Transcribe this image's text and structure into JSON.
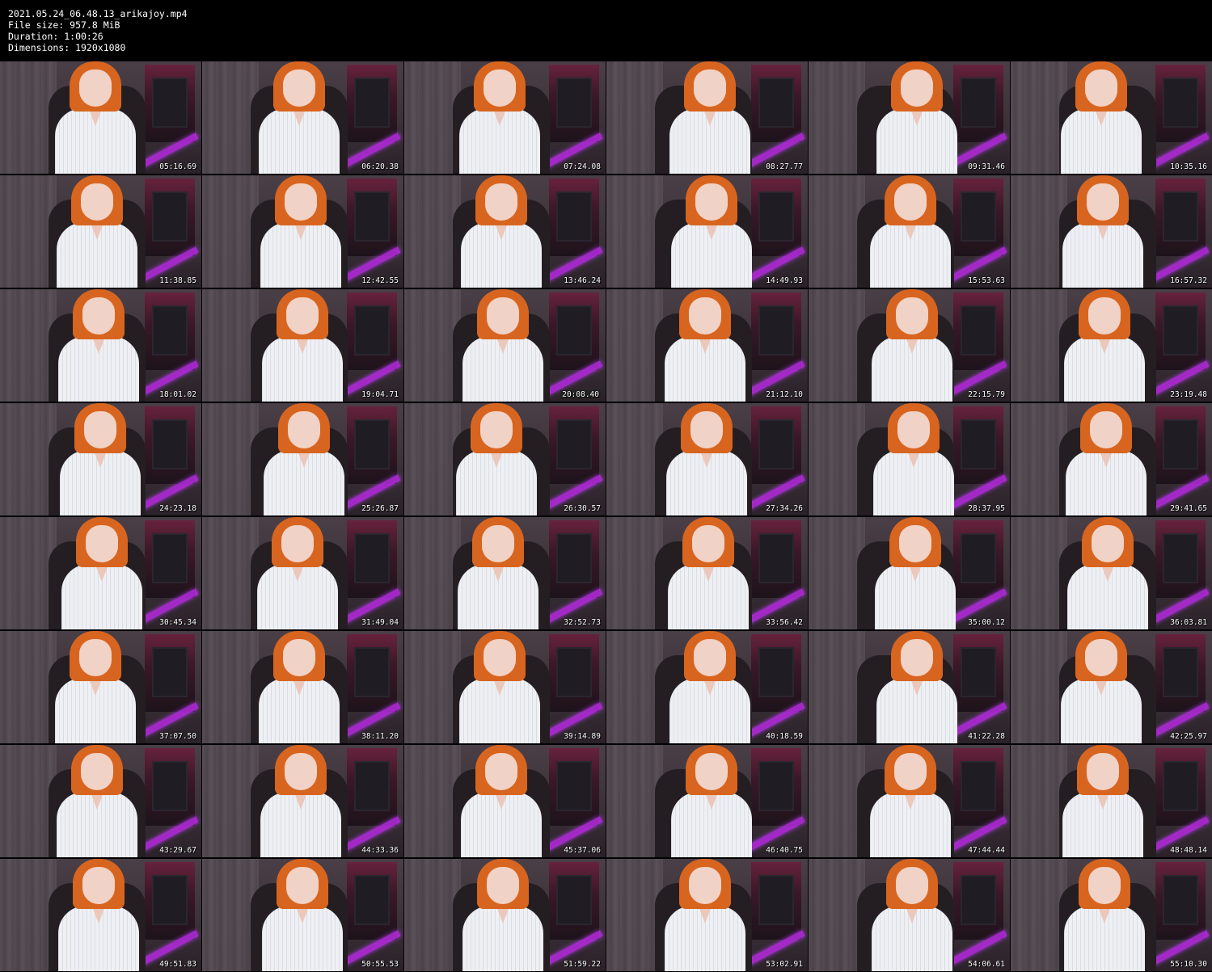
{
  "header": {
    "filename": "2021.05.24_06.48.13_arikajoy.mp4",
    "file_size": "File size: 957.8 MiB",
    "duration": "Duration: 1:00:26",
    "dimensions": "Dimensions: 1920x1080"
  },
  "thumbnails": [
    "05:16.69",
    "06:20.38",
    "07:24.08",
    "08:27.77",
    "09:31.46",
    "10:35.16",
    "11:38.85",
    "12:42.55",
    "13:46.24",
    "14:49.93",
    "15:53.63",
    "16:57.32",
    "18:01.02",
    "19:04.71",
    "20:08.40",
    "21:12.10",
    "22:15.79",
    "23:19.48",
    "24:23.18",
    "25:26.87",
    "26:30.57",
    "27:34.26",
    "28:37.95",
    "29:41.65",
    "30:45.34",
    "31:49.04",
    "32:52.73",
    "33:56.42",
    "35:00.12",
    "36:03.81",
    "37:07.50",
    "38:11.20",
    "39:14.89",
    "40:18.59",
    "41:22.28",
    "42:25.97",
    "43:29.67",
    "44:33.36",
    "45:37.06",
    "46:40.75",
    "47:44.44",
    "48:48.14",
    "49:51.83",
    "50:55.53",
    "51:59.22",
    "53:02.91",
    "54:06.61",
    "55:10.30"
  ]
}
